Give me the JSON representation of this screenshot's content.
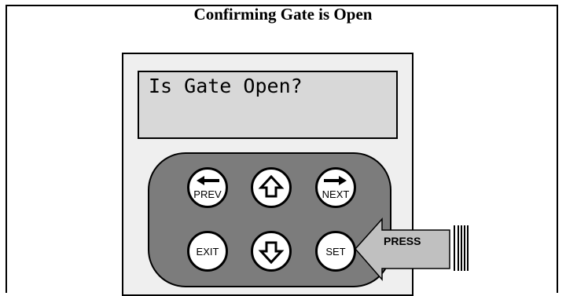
{
  "title": "Confirming Gate is Open",
  "lcd": {
    "text": "Is Gate Open?"
  },
  "keys": {
    "prev": "PREV",
    "up": "",
    "next": "NEXT",
    "exit": "EXIT",
    "down": "",
    "set": "SET"
  },
  "callout": {
    "label": "PRESS"
  },
  "icons": {
    "prev": "left-arrow-icon",
    "up": "up-arrow-icon",
    "next": "right-arrow-icon",
    "down": "down-arrow-icon"
  },
  "colors": {
    "keypad": "#7c7c7c",
    "lcd": "#d8d8d8",
    "device": "#efefef",
    "press_arrow": "#c0c0c0"
  }
}
